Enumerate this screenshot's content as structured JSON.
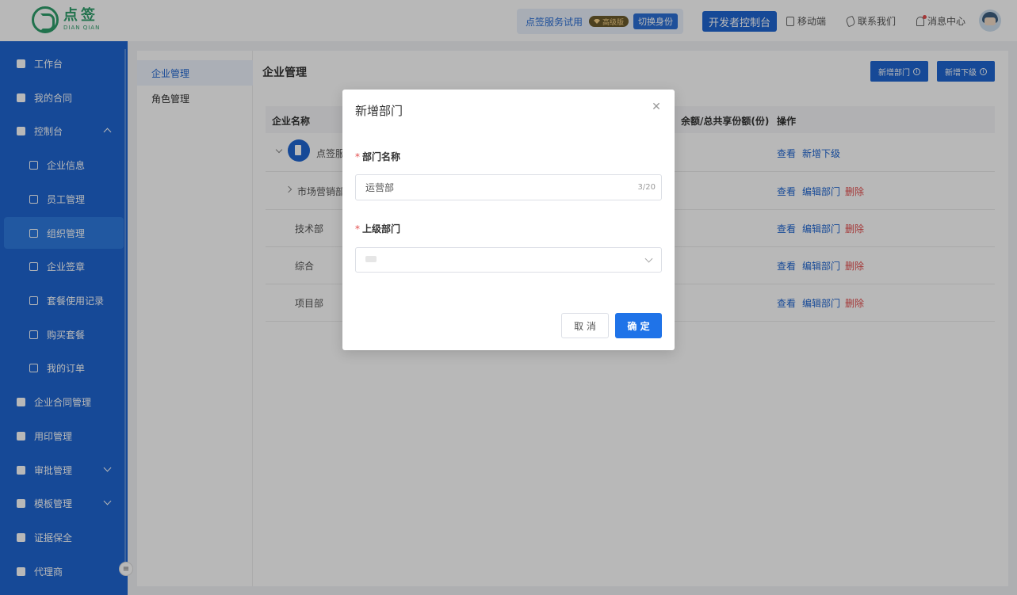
{
  "header": {
    "logo_cn": "点签",
    "logo_en": "DIAN QIAN",
    "trial_text": "点签服务试用",
    "vip_badge": "高级版",
    "switch_identity": "切换身份",
    "developer_console": "开发者控制台",
    "mobile": "移动端",
    "contact_us": "联系我们",
    "message_center": "消息中心"
  },
  "sidebar": {
    "items": [
      {
        "label": "工作台",
        "icon": "home-icon"
      },
      {
        "label": "我的合同",
        "icon": "contract-icon"
      },
      {
        "label": "控制台",
        "icon": "console-icon"
      },
      {
        "label": "企业信息",
        "icon": "building-icon"
      },
      {
        "label": "员工管理",
        "icon": "user-icon"
      },
      {
        "label": "组织管理",
        "icon": "org-icon"
      },
      {
        "label": "企业签章",
        "icon": "stamp-icon"
      },
      {
        "label": "套餐使用记录",
        "icon": "record-icon"
      },
      {
        "label": "购买套餐",
        "icon": "cart-icon"
      },
      {
        "label": "我的订单",
        "icon": "order-icon"
      },
      {
        "label": "企业合同管理",
        "icon": "doc-icon"
      },
      {
        "label": "用印管理",
        "icon": "seal-icon"
      },
      {
        "label": "审批管理",
        "icon": "approve-icon"
      },
      {
        "label": "模板管理",
        "icon": "template-icon"
      },
      {
        "label": "证据保全",
        "icon": "evidence-icon"
      },
      {
        "label": "代理商",
        "icon": "agent-icon"
      }
    ]
  },
  "subnav": {
    "items": [
      "企业管理",
      "角色管理"
    ]
  },
  "content": {
    "title": "企业管理",
    "add_department": "新增部门",
    "add_subordinate": "新增下级",
    "columns": {
      "name": "企业名称",
      "quota": "余额/总共享份额(份)",
      "action": "操作"
    },
    "rows": [
      {
        "name": "点签服",
        "ops": [
          "查看",
          "新增下级"
        ]
      },
      {
        "name": "市场营销部",
        "ops": [
          "查看",
          "编辑部门",
          "删除"
        ]
      },
      {
        "name": "技术部",
        "ops": [
          "查看",
          "编辑部门",
          "删除"
        ]
      },
      {
        "name": "综合",
        "ops": [
          "查看",
          "编辑部门",
          "删除"
        ]
      },
      {
        "name": "项目部",
        "ops": [
          "查看",
          "编辑部门",
          "删除"
        ]
      }
    ]
  },
  "modal": {
    "title": "新增部门",
    "dept_name_label": "部门名称",
    "dept_name_value": "运营部",
    "char_count": "3/20",
    "parent_label": "上级部门",
    "cancel": "取 消",
    "confirm": "确 定"
  }
}
